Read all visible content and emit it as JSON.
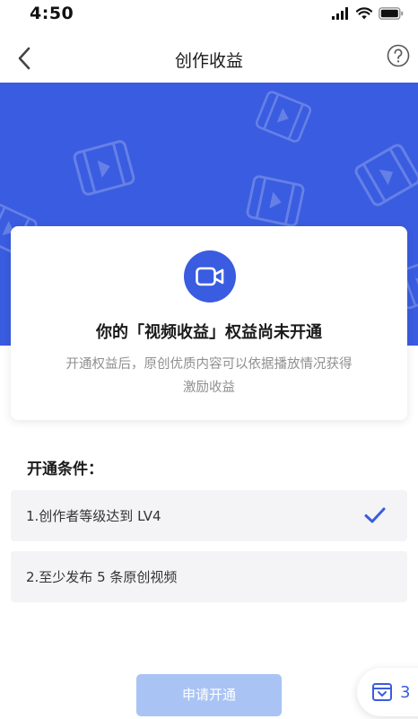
{
  "status_bar": {
    "time": "4:50",
    "icons": [
      "signal-icon",
      "wifi-icon",
      "battery-icon"
    ]
  },
  "nav": {
    "title": "创作收益",
    "back_icon": "chevron-left-icon",
    "help_icon": "question-circle-icon"
  },
  "banner": {
    "background_color": "#3a5ce0",
    "decor_icon": "film-icon"
  },
  "card": {
    "icon": "video-camera-icon",
    "title": "你的「视频收益」权益尚未开通",
    "desc_line1": "开通权益后，原创优质内容可以依据播放情况获得",
    "desc_line2": "激励收益"
  },
  "conditions": {
    "heading": "开通条件：",
    "items": [
      {
        "label": "1.创作者等级达到 LV4",
        "met": true
      },
      {
        "label": "2.至少发布 5 条原创视频",
        "met": false
      }
    ]
  },
  "apply_button": {
    "label": "申请开通",
    "color": "#a9c4f4"
  },
  "floating": {
    "icon": "inbox-icon",
    "count": "3"
  }
}
